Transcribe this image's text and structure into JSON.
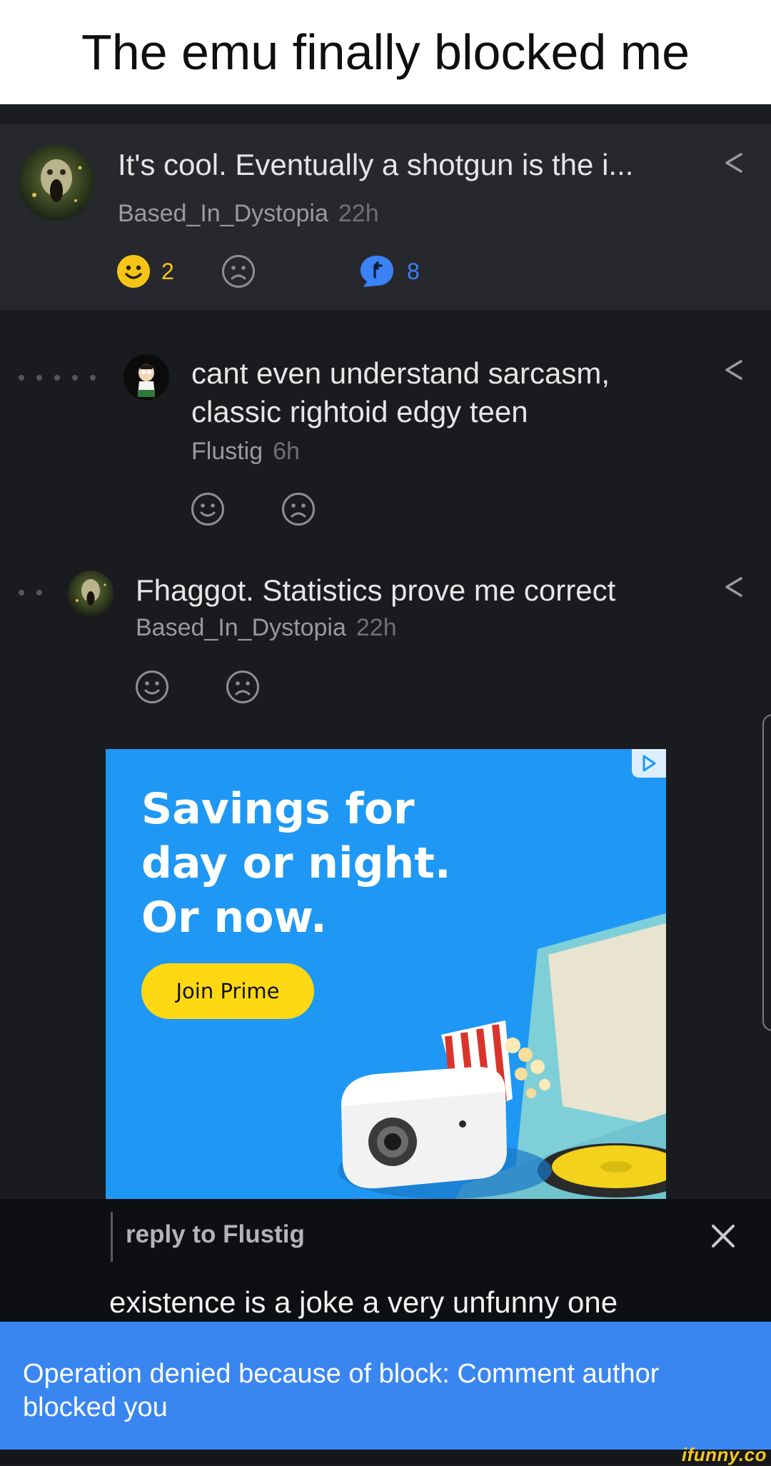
{
  "caption": "The emu finally blocked me",
  "comments": [
    {
      "text": "It's cool. Eventually a shotgun is the i...",
      "author": "Based_In_Dystopia",
      "time": "22h",
      "smile_count": "2",
      "reply_count": "8"
    },
    {
      "text_line1": "cant even understand sarcasm,",
      "text_line2": "classic rightoid edgy teen",
      "author": "Flustig",
      "time": "6h"
    },
    {
      "text": "Fhaggot. Statistics prove me correct",
      "author": "Based_In_Dystopia",
      "time": "22h"
    }
  ],
  "ad": {
    "headline": "Savings for\nday or night.\nOr now.",
    "cta": "Join Prime"
  },
  "reply": {
    "label": "reply to Flustig",
    "input_text": "existence is a joke a very unfunny one"
  },
  "toast": "Operation denied because of block: Comment author blocked you",
  "watermark": "ifunny.co",
  "colors": {
    "smile_active": "#f5c518",
    "reply_accent": "#3b82f6",
    "toast_bg": "#3a86f1",
    "ad_bg": "#1e98f4",
    "ad_cta": "#ffd814"
  },
  "icons": [
    "share-icon",
    "smile-icon",
    "frown-icon",
    "reply-bubble-icon",
    "close-icon",
    "ad-choices-icon"
  ]
}
